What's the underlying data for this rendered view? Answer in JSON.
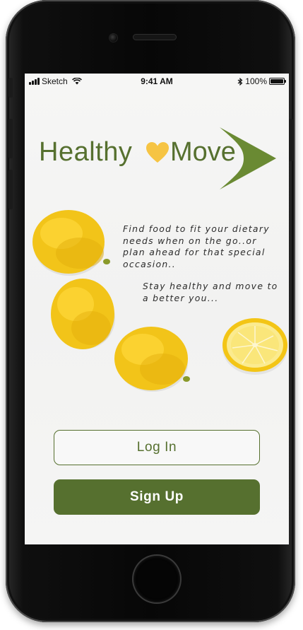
{
  "status_bar": {
    "carrier": "Sketch",
    "time": "9:41 AM",
    "battery_label": "100%",
    "battery_level": 1.0
  },
  "logo": {
    "word_1": "Healthy",
    "word_2": "Move",
    "heart_color": "#f6c443",
    "brand_color": "#56702f"
  },
  "tagline": {
    "line_1": "Find food to fit your dietary needs when on the go..or plan ahead for that special occasion..",
    "line_2": "Stay healthy and move to a better you..."
  },
  "buttons": {
    "login_label": "Log In",
    "signup_label": "Sign Up"
  },
  "icons": {
    "signal": "cellular-signal-icon",
    "wifi": "wifi-icon",
    "bluetooth": "bluetooth-icon",
    "battery": "battery-icon",
    "heart": "heart-icon",
    "arrow": "chevron-arrow-icon"
  }
}
